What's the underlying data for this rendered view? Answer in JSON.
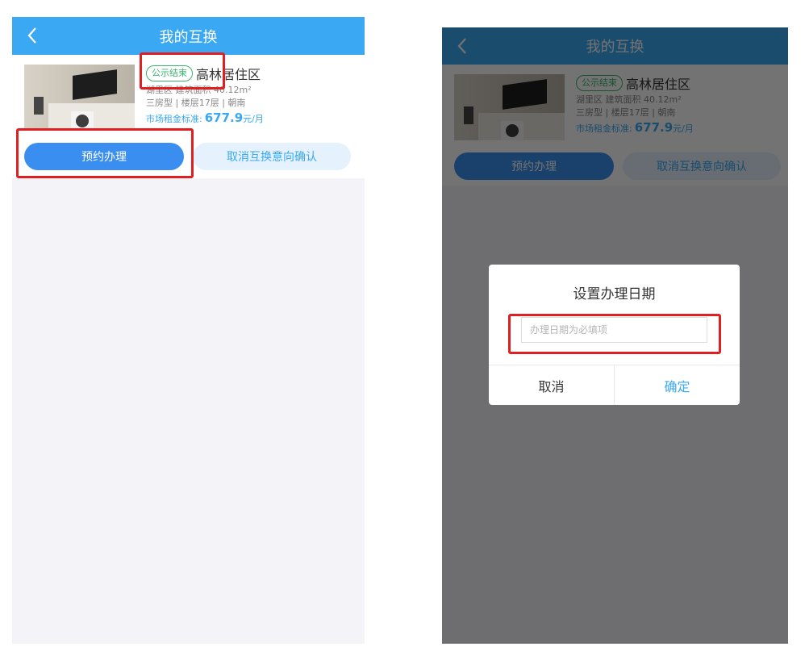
{
  "header": {
    "title": "我的互换"
  },
  "listing": {
    "status_badge": "公示结束",
    "name": "高林居住区",
    "district_area": "湖里区  建筑面积 40.12m²",
    "layout_floor_orientation": "三房型 | 楼层17层 | 朝南",
    "rent_label": "市场租金标准:",
    "rent_value": "677.9",
    "rent_unit": "元/月"
  },
  "actions": {
    "book_label": "预约办理",
    "cancel_intent_label": "取消互换意向确认"
  },
  "dialog": {
    "title": "设置办理日期",
    "date_placeholder": "办理日期为必填项",
    "cancel_label": "取消",
    "confirm_label": "确定"
  },
  "colors": {
    "header_bg": "#3aa8f3",
    "primary_button": "#3a8ef0",
    "badge_green": "#3ab56d",
    "highlight_red": "#e02020"
  },
  "icons": {
    "back": "chevron-left-icon"
  }
}
